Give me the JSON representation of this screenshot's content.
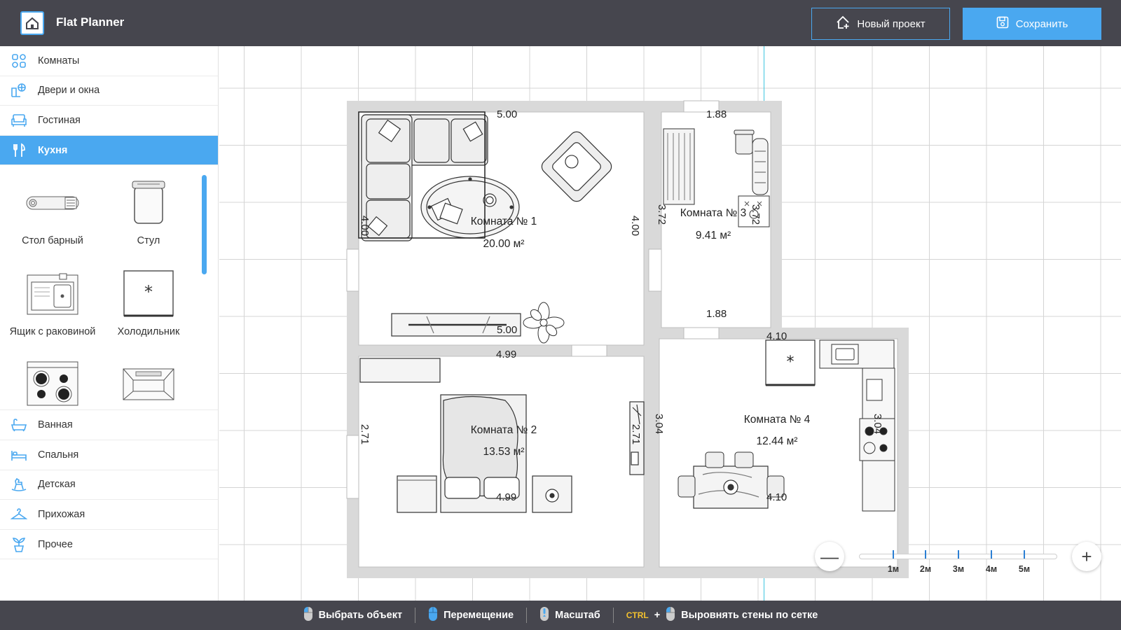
{
  "header": {
    "app_title": "Flat Planner",
    "new_project_label": "Новый проект",
    "save_label": "Сохранить"
  },
  "sidebar": {
    "categories_top": [
      {
        "label": "Комнаты",
        "icon": "rooms-icon"
      },
      {
        "label": "Двери и окна",
        "icon": "doors-windows-icon"
      },
      {
        "label": "Гостиная",
        "icon": "sofa-icon"
      },
      {
        "label": "Кухня",
        "icon": "kitchen-icon",
        "active": true
      }
    ],
    "items": [
      {
        "label": "Стол барный",
        "icon": "bar-table-icon"
      },
      {
        "label": "Стул",
        "icon": "chair-icon"
      },
      {
        "label": "Ящик с раковиной",
        "icon": "sink-cabinet-icon"
      },
      {
        "label": "Холодильник",
        "icon": "fridge-icon"
      },
      {
        "label": "",
        "icon": "stove-icon"
      },
      {
        "label": "",
        "icon": "hood-icon"
      }
    ],
    "categories_bottom": [
      {
        "label": "Ванная",
        "icon": "bathtub-icon"
      },
      {
        "label": "Спальня",
        "icon": "bed-icon"
      },
      {
        "label": "Детская",
        "icon": "rocking-horse-icon"
      },
      {
        "label": "Прихожая",
        "icon": "hanger-icon"
      },
      {
        "label": "Прочее",
        "icon": "plant-icon"
      }
    ]
  },
  "plan": {
    "rooms": [
      {
        "name": "Комната №  1",
        "area": "20.00 м²"
      },
      {
        "name": "Комната №  2",
        "area": "13.53 м²"
      },
      {
        "name": "Комната №  3",
        "area": "9.41 м²"
      },
      {
        "name": "Комната №  4",
        "area": "12.44 м²"
      }
    ],
    "dims": {
      "r1_top": "5.00",
      "r1_bottom": "5.00",
      "r1_left": "4.00",
      "r1_right": "4.00",
      "r2_top": "4.99",
      "r2_bottom": "4.99",
      "r2_left": "2.71",
      "r2_right": "2.71",
      "r3_top": "1.88",
      "r3_bottom": "1.88",
      "r3_left": "3.72",
      "r3_right": "3.72",
      "r4_top": "4.10",
      "r4_bottom": "4.10",
      "r4_left": "3.04",
      "r4_right": "3.04"
    }
  },
  "zoom": {
    "minus": "—",
    "plus": "+",
    "scale_labels": [
      "1м",
      "2м",
      "3м",
      "4м",
      "5м"
    ]
  },
  "footer": {
    "select": "Выбрать объект",
    "move": "Перемещение",
    "zoom": "Масштаб",
    "ctrl": "CTRL",
    "plus": "+",
    "align": "Выровнять стены по сетке"
  },
  "colors": {
    "accent": "#4aa8f0",
    "header_bg": "#46464e",
    "wall": "#d9d9d9",
    "guide": "#3ec6e0"
  }
}
